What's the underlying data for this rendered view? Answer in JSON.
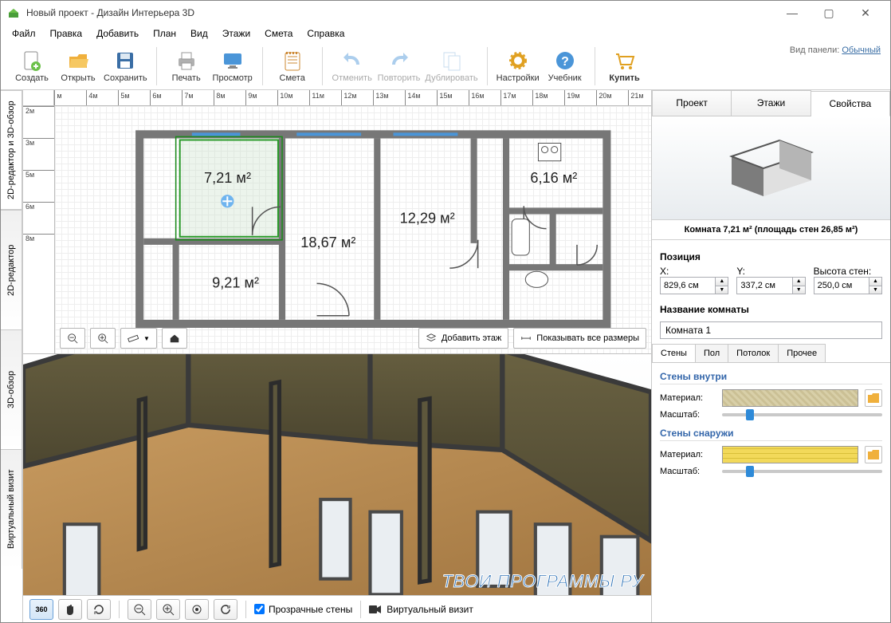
{
  "window": {
    "title": "Новый проект - Дизайн Интерьера 3D"
  },
  "menu": [
    "Файл",
    "Правка",
    "Добавить",
    "План",
    "Вид",
    "Этажи",
    "Смета",
    "Справка"
  ],
  "panel_hint": {
    "label": "Вид панели:",
    "value": "Обычный"
  },
  "toolbar": {
    "create": "Создать",
    "open": "Открыть",
    "save": "Сохранить",
    "print": "Печать",
    "preview": "Просмотр",
    "estimate": "Смета",
    "undo": "Отменить",
    "redo": "Повторить",
    "duplicate": "Дублировать",
    "settings": "Настройки",
    "tutorial": "Учебник",
    "buy": "Купить"
  },
  "vtabs": [
    "2D-редактор и 3D-обзор",
    "2D-редактор",
    "3D-обзор",
    "Виртуальный визит"
  ],
  "ruler_h": [
    "м",
    "4м",
    "5м",
    "6м",
    "7м",
    "8м",
    "9м",
    "10м",
    "11м",
    "12м",
    "13м",
    "14м",
    "15м",
    "16м",
    "17м",
    "18м",
    "19м",
    "20м",
    "21м"
  ],
  "ruler_v": [
    "2м",
    "3м",
    "5м",
    "6м",
    "8м"
  ],
  "rooms": [
    "7,21 м²",
    "6,16 м²",
    "12,29 м²",
    "18,67 м²",
    "9,21 м²"
  ],
  "plan_actions": {
    "add_floor": "Добавить этаж",
    "show_dims": "Показывать все размеры"
  },
  "bottom": {
    "transparent": "Прозрачные стены",
    "virtual": "Виртуальный визит",
    "btn360": "360"
  },
  "side": {
    "tabs": [
      "Проект",
      "Этажи",
      "Свойства"
    ],
    "preview_label": "Комната 7,21 м²  (площадь стен 26,85 м²)",
    "position": "Позиция",
    "pos_labels": {
      "x": "X:",
      "y": "Y:",
      "h": "Высота стен:"
    },
    "pos": {
      "x": "829,6 см",
      "y": "337,2 см",
      "h": "250,0 см"
    },
    "name_label": "Название комнаты",
    "name_value": "Комната 1",
    "sub_tabs": [
      "Стены",
      "Пол",
      "Потолок",
      "Прочее"
    ],
    "walls_in": "Стены внутри",
    "walls_out": "Стены снаружи",
    "material": "Материал:",
    "scale": "Масштаб:"
  },
  "watermark": "ТВОИ ПРОГРАММЫ РУ"
}
